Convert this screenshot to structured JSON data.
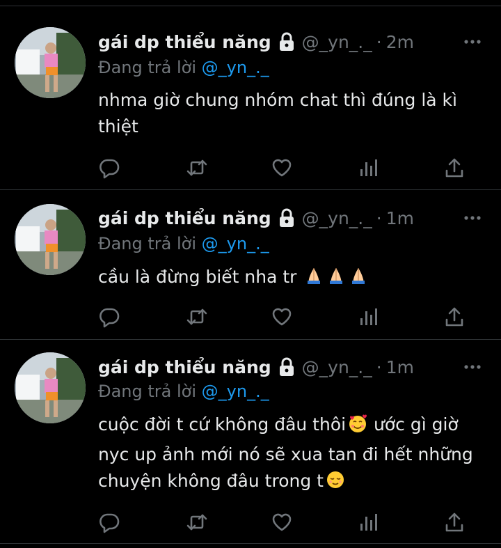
{
  "tweets": [
    {
      "author_name": "gái dp thiểu năng",
      "handle": "@_yn_._",
      "separator": "·",
      "time": "2m",
      "reply_prefix": "Đang trả lời",
      "reply_handle": "@_yn_._",
      "lines": [
        "nhma giờ chung nhóm chat thì đúng là kì",
        "thiệt"
      ]
    },
    {
      "author_name": "gái dp thiểu năng",
      "handle": "@_yn_._",
      "separator": "·",
      "time": "1m",
      "reply_prefix": "Đang trả lời",
      "reply_handle": "@_yn_._",
      "lines": [
        "cầu là đừng biết nha tr"
      ],
      "emojis": [
        "folded-hands",
        "folded-hands",
        "folded-hands"
      ]
    },
    {
      "author_name": "gái dp thiểu năng",
      "handle": "@_yn_._",
      "separator": "·",
      "time": "1m",
      "reply_prefix": "Đang trả lời",
      "reply_handle": "@_yn_._",
      "line1_a": "cuộc đời t cứ không đâu thôi",
      "line1_emoji": "smiling-face-with-hearts",
      "line1_b": " ước gì giờ",
      "line2": "nyc up ảnh mới nó sẽ xua tan đi hết những",
      "line3": "chuyện không đâu trong t",
      "line3_emoji": "relieved-face"
    }
  ],
  "icons": {
    "more": "more-dots-icon",
    "lock": "lock-icon",
    "reply": "reply-icon",
    "retweet": "retweet-icon",
    "like": "like-icon",
    "views": "views-icon",
    "share": "share-icon"
  },
  "colors": {
    "background": "#000000",
    "text": "#e7e9ea",
    "muted": "#71767b",
    "link": "#1d9bf0",
    "divider": "#2f3336"
  }
}
